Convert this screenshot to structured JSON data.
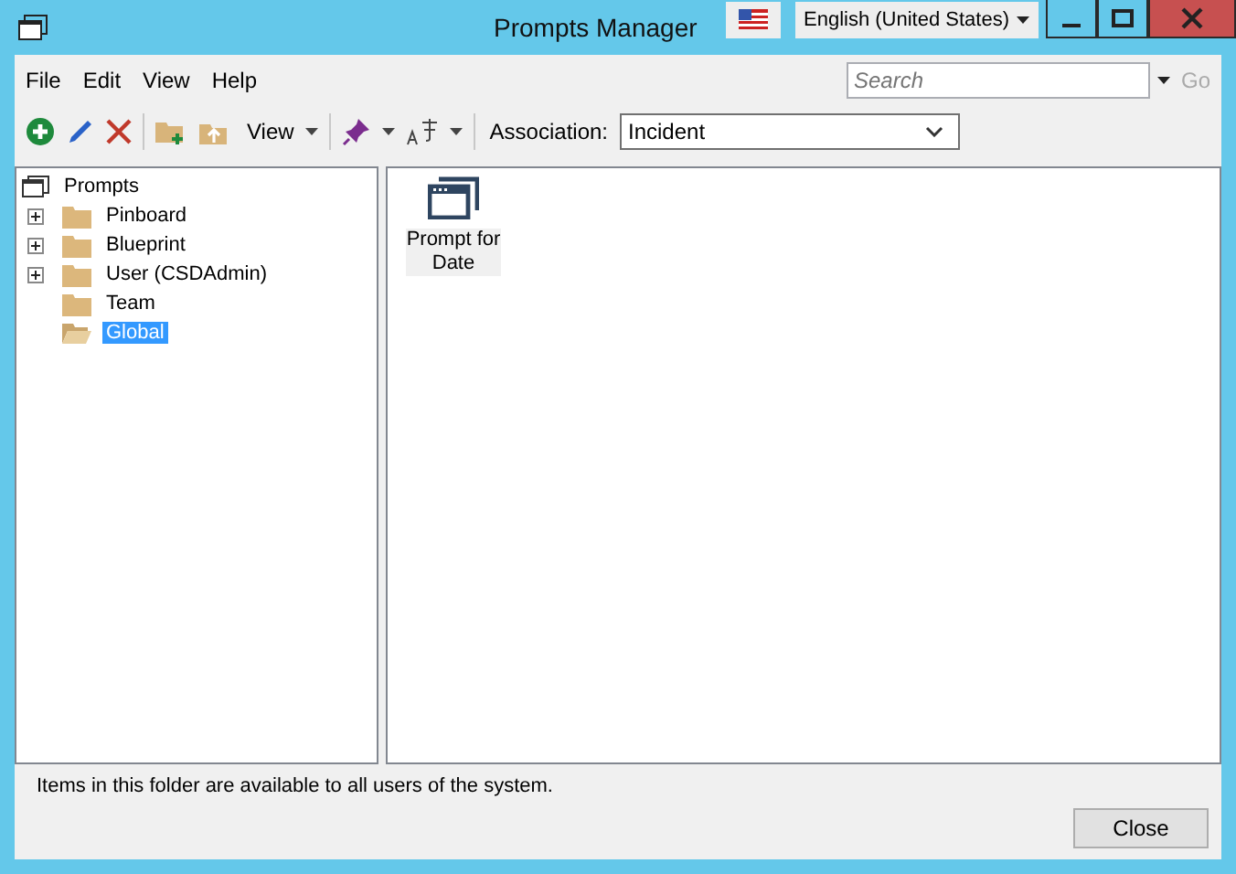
{
  "window": {
    "title": "Prompts Manager"
  },
  "language": {
    "value": "English (United States)"
  },
  "menu": [
    "File",
    "Edit",
    "View",
    "Help"
  ],
  "search": {
    "placeholder": "Search",
    "go": "Go"
  },
  "toolbar": {
    "view": "View",
    "association_label": "Association:",
    "association": "Incident"
  },
  "tree": {
    "root": "Prompts",
    "items": [
      {
        "label": "Pinboard",
        "expandable": true,
        "selected": false
      },
      {
        "label": "Blueprint",
        "expandable": true,
        "selected": false
      },
      {
        "label": "User (CSDAdmin)",
        "expandable": true,
        "selected": false
      },
      {
        "label": "Team",
        "expandable": false,
        "selected": false
      },
      {
        "label": "Global",
        "expandable": false,
        "selected": true
      }
    ]
  },
  "items": [
    {
      "label": "Prompt for Date"
    }
  ],
  "status": "Items in this folder are available to all users of the system.",
  "close_button": "Close"
}
